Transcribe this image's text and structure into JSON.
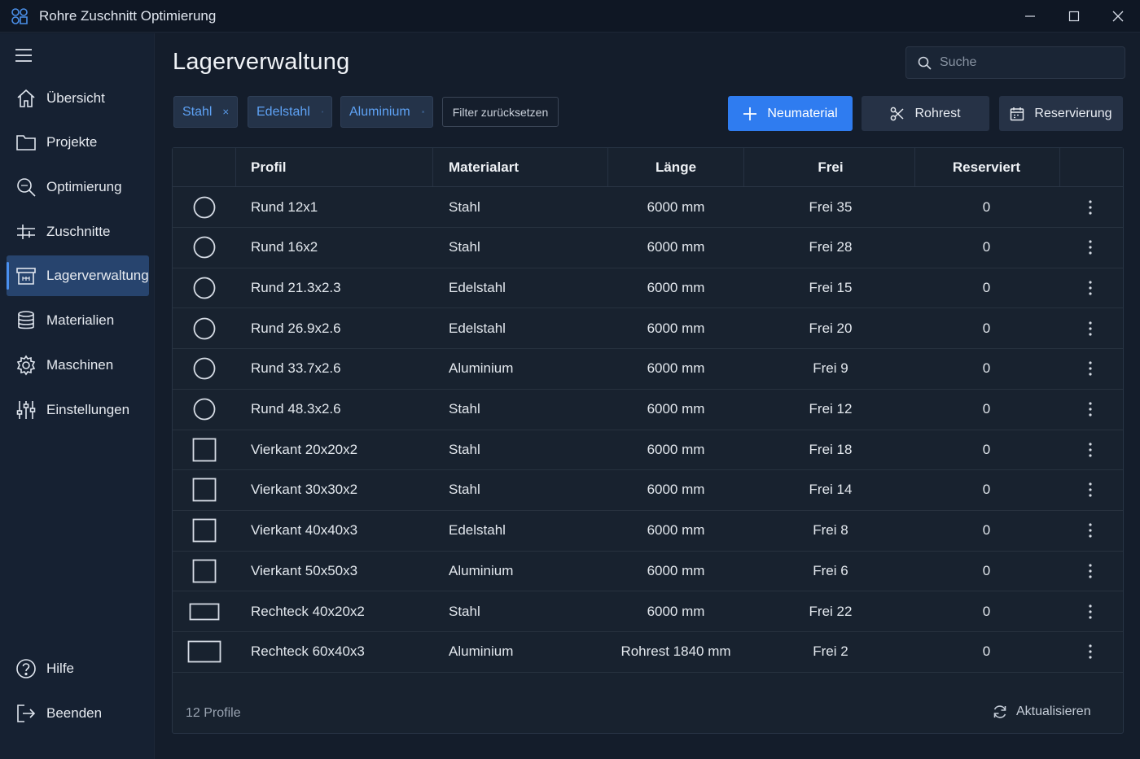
{
  "window": {
    "title": "Rohre Zuschnitt Optimierung"
  },
  "sidebar": {
    "items": [
      {
        "label": "Übersicht",
        "icon": "home-icon"
      },
      {
        "label": "Projekte",
        "icon": "folder-icon"
      },
      {
        "label": "Optimierung",
        "icon": "magnifier-icon"
      },
      {
        "label": "Zuschnitte",
        "icon": "cut-lines-icon"
      },
      {
        "label": "Lagerverwaltung",
        "icon": "archive-box-icon",
        "active": true
      },
      {
        "label": "Materialien",
        "icon": "database-icon"
      },
      {
        "label": "Maschinen",
        "icon": "gear-icon"
      },
      {
        "label": "Einstellungen",
        "icon": "sliders-icon"
      }
    ],
    "bottom_items": [
      {
        "label": "Hilfe",
        "icon": "help-icon"
      },
      {
        "label": "Beenden",
        "icon": "exit-icon"
      }
    ]
  },
  "main": {
    "title": "Lagerverwaltung",
    "search": {
      "placeholder": "Suche",
      "value": ""
    },
    "filters": [
      {
        "label": "Stahl"
      },
      {
        "label": "Edelstahl"
      },
      {
        "label": "Aluminium"
      }
    ],
    "filter_reset_label": "Filter zurücksetzen",
    "actions": {
      "new_material": "Neumaterial",
      "rohrest": "Rohrest",
      "reservierung": "Reservierung"
    }
  },
  "table": {
    "columns": [
      "Profil",
      "Materialart",
      "Länge",
      "Frei",
      "Reserviert"
    ],
    "rows": [
      {
        "shape": "round",
        "profil": "Rund 12x1",
        "material": "Stahl",
        "laenge": "6000 mm",
        "frei": "Frei 35",
        "reserviert": "0"
      },
      {
        "shape": "round",
        "profil": "Rund 16x2",
        "material": "Stahl",
        "laenge": "6000 mm",
        "frei": "Frei 28",
        "reserviert": "0"
      },
      {
        "shape": "round",
        "profil": "Rund 21.3x2.3",
        "material": "Edelstahl",
        "laenge": "6000 mm",
        "frei": "Frei 15",
        "reserviert": "0"
      },
      {
        "shape": "round",
        "profil": "Rund 26.9x2.6",
        "material": "Edelstahl",
        "laenge": "6000 mm",
        "frei": "Frei 20",
        "reserviert": "0"
      },
      {
        "shape": "round",
        "profil": "Rund 33.7x2.6",
        "material": "Aluminium",
        "laenge": "6000 mm",
        "frei": "Frei 9",
        "reserviert": "0"
      },
      {
        "shape": "round",
        "profil": "Rund 48.3x2.6",
        "material": "Stahl",
        "laenge": "6000 mm",
        "frei": "Frei 12",
        "reserviert": "0"
      },
      {
        "shape": "square",
        "profil": "Vierkant 20x20x2",
        "material": "Stahl",
        "laenge": "6000 mm",
        "frei": "Frei 18",
        "reserviert": "0"
      },
      {
        "shape": "square",
        "profil": "Vierkant 30x30x2",
        "material": "Stahl",
        "laenge": "6000 mm",
        "frei": "Frei 14",
        "reserviert": "0"
      },
      {
        "shape": "square",
        "profil": "Vierkant 40x40x3",
        "material": "Edelstahl",
        "laenge": "6000 mm",
        "frei": "Frei 8",
        "reserviert": "0"
      },
      {
        "shape": "square",
        "profil": "Vierkant 50x50x3",
        "material": "Aluminium",
        "laenge": "6000 mm",
        "frei": "Frei 6",
        "reserviert": "0"
      },
      {
        "shape": "rect",
        "profil": "Rechteck 40x20x2",
        "material": "Stahl",
        "laenge": "6000 mm",
        "frei": "Frei 22",
        "reserviert": "0"
      },
      {
        "shape": "rect-large",
        "profil": "Rechteck 60x40x3",
        "material": "Aluminium",
        "laenge": "Rohrest 1840 mm",
        "frei": "Frei 2",
        "reserviert": "0"
      }
    ],
    "footer": {
      "count_label": "12 Profile",
      "refresh_label": "Aktualisieren"
    }
  },
  "colors": {
    "accent": "#2f7cf0",
    "chip_text": "#5ea2f5",
    "active_nav": "#27446e"
  }
}
